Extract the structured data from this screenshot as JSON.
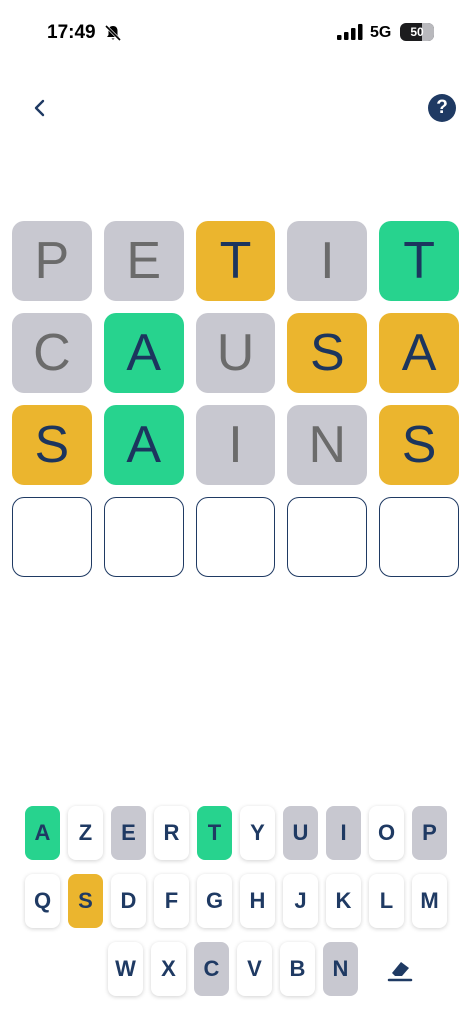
{
  "status_bar": {
    "time": "17:49",
    "network": "5G",
    "battery": "50"
  },
  "header": {
    "back_icon": "chevron-left-icon",
    "help_label": "?"
  },
  "colors": {
    "gray": "#c8c8d0",
    "yellow": "#ebb52e",
    "green": "#27d38e",
    "navy": "#1f3a63"
  },
  "board": {
    "rows": [
      [
        {
          "letter": "P",
          "state": "gray"
        },
        {
          "letter": "E",
          "state": "gray"
        },
        {
          "letter": "T",
          "state": "yellow"
        },
        {
          "letter": "I",
          "state": "gray"
        },
        {
          "letter": "T",
          "state": "green"
        }
      ],
      [
        {
          "letter": "C",
          "state": "gray"
        },
        {
          "letter": "A",
          "state": "green"
        },
        {
          "letter": "U",
          "state": "gray"
        },
        {
          "letter": "S",
          "state": "yellow"
        },
        {
          "letter": "A",
          "state": "yellow"
        }
      ],
      [
        {
          "letter": "S",
          "state": "yellow"
        },
        {
          "letter": "A",
          "state": "green"
        },
        {
          "letter": "I",
          "state": "gray"
        },
        {
          "letter": "N",
          "state": "gray"
        },
        {
          "letter": "S",
          "state": "yellow"
        }
      ],
      [
        {
          "letter": "",
          "state": "empty"
        },
        {
          "letter": "",
          "state": "empty"
        },
        {
          "letter": "",
          "state": "empty"
        },
        {
          "letter": "",
          "state": "empty"
        },
        {
          "letter": "",
          "state": "empty"
        }
      ]
    ]
  },
  "keyboard": {
    "rows": [
      [
        {
          "k": "A",
          "s": "green"
        },
        {
          "k": "Z",
          "s": "none"
        },
        {
          "k": "E",
          "s": "gray"
        },
        {
          "k": "R",
          "s": "none"
        },
        {
          "k": "T",
          "s": "green"
        },
        {
          "k": "Y",
          "s": "none"
        },
        {
          "k": "U",
          "s": "gray"
        },
        {
          "k": "I",
          "s": "gray"
        },
        {
          "k": "O",
          "s": "none"
        },
        {
          "k": "P",
          "s": "gray"
        }
      ],
      [
        {
          "k": "Q",
          "s": "none"
        },
        {
          "k": "S",
          "s": "yellow"
        },
        {
          "k": "D",
          "s": "none"
        },
        {
          "k": "F",
          "s": "none"
        },
        {
          "k": "G",
          "s": "none"
        },
        {
          "k": "H",
          "s": "none"
        },
        {
          "k": "J",
          "s": "none"
        },
        {
          "k": "K",
          "s": "none"
        },
        {
          "k": "L",
          "s": "none"
        },
        {
          "k": "M",
          "s": "none"
        }
      ],
      [
        {
          "k": "W",
          "s": "none"
        },
        {
          "k": "X",
          "s": "none"
        },
        {
          "k": "C",
          "s": "gray"
        },
        {
          "k": "V",
          "s": "none"
        },
        {
          "k": "B",
          "s": "none"
        },
        {
          "k": "N",
          "s": "gray"
        }
      ]
    ],
    "erase_icon": "eraser-icon"
  }
}
